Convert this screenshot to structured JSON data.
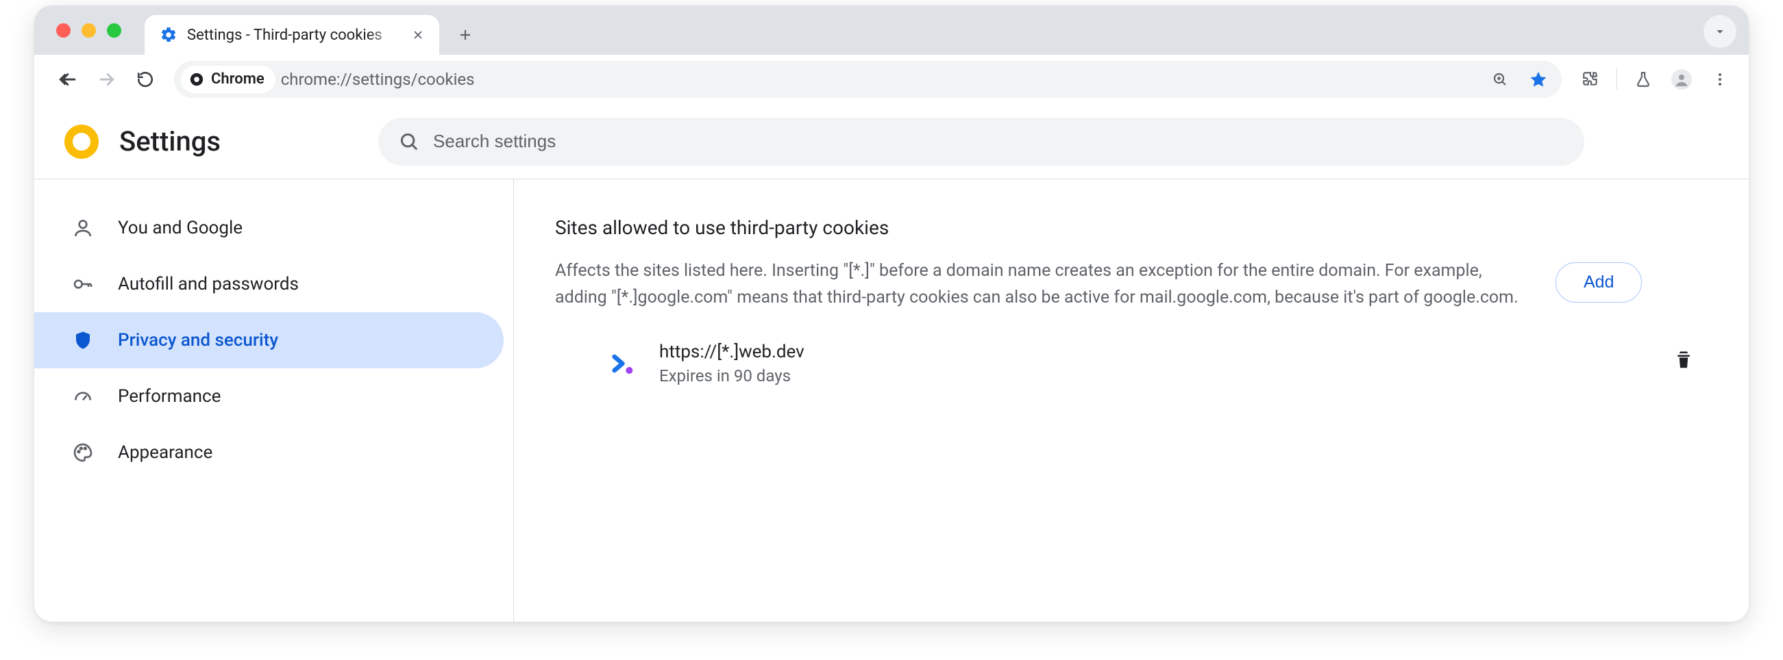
{
  "window": {
    "tab_title": "Settings - Third-party cookies"
  },
  "toolbar": {
    "chip_label": "Chrome",
    "url": "chrome://settings/cookies"
  },
  "header": {
    "title": "Settings",
    "search_placeholder": "Search settings"
  },
  "sidebar": {
    "items": [
      {
        "label": "You and Google"
      },
      {
        "label": "Autofill and passwords"
      },
      {
        "label": "Privacy and security"
      },
      {
        "label": "Performance"
      },
      {
        "label": "Appearance"
      }
    ]
  },
  "content": {
    "section_title": "Sites allowed to use third-party cookies",
    "section_desc": "Affects the sites listed here. Inserting \"[*.]\" before a domain name creates an exception for the entire domain. For example, adding \"[*.]google.com\" means that third-party cookies can also be active for mail.google.com, because it's part of google.com.",
    "add_label": "Add",
    "site": {
      "url": "https://[*.]web.dev",
      "expires": "Expires in 90 days"
    }
  }
}
